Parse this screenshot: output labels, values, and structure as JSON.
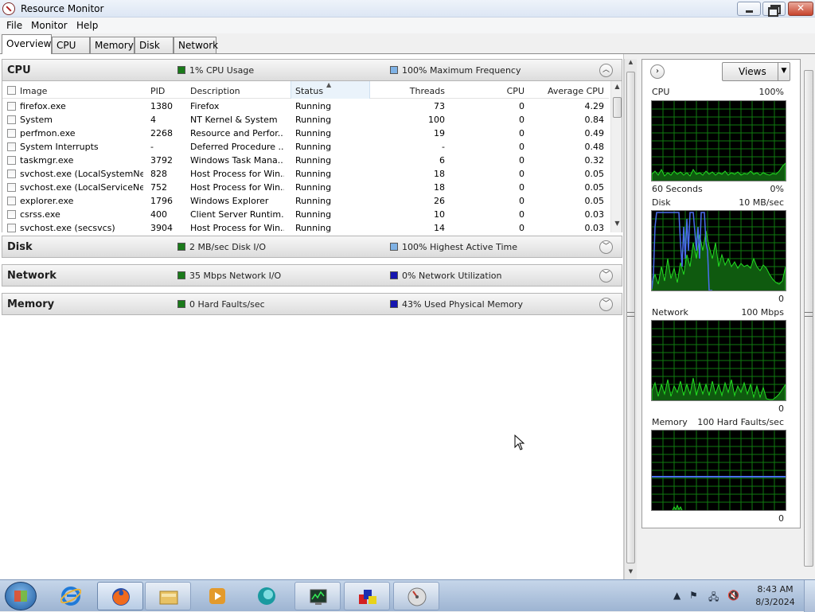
{
  "window": {
    "title": "Resource Monitor"
  },
  "menu": [
    "File",
    "Monitor",
    "Help"
  ],
  "tabs": [
    "Overview",
    "CPU",
    "Memory",
    "Disk",
    "Network"
  ],
  "cpu_section": {
    "title": "CPU",
    "usage": "1% CPU Usage",
    "frequency": "100% Maximum Frequency",
    "columns": [
      "Image",
      "PID",
      "Description",
      "Status",
      "Threads",
      "CPU",
      "Average CPU"
    ],
    "rows": [
      [
        "firefox.exe",
        "1380",
        "Firefox",
        "Running",
        "73",
        "0",
        "4.29"
      ],
      [
        "System",
        "4",
        "NT Kernel & System",
        "Running",
        "100",
        "0",
        "0.84"
      ],
      [
        "perfmon.exe",
        "2268",
        "Resource and Perfor...",
        "Running",
        "19",
        "0",
        "0.49"
      ],
      [
        "System Interrupts",
        "-",
        "Deferred Procedure ...",
        "Running",
        "-",
        "0",
        "0.48"
      ],
      [
        "taskmgr.exe",
        "3792",
        "Windows Task Mana...",
        "Running",
        "6",
        "0",
        "0.32"
      ],
      [
        "svchost.exe (LocalSystemNet...",
        "828",
        "Host Process for Win...",
        "Running",
        "18",
        "0",
        "0.05"
      ],
      [
        "svchost.exe (LocalServiceNet...",
        "752",
        "Host Process for Win...",
        "Running",
        "18",
        "0",
        "0.05"
      ],
      [
        "explorer.exe",
        "1796",
        "Windows Explorer",
        "Running",
        "26",
        "0",
        "0.05"
      ],
      [
        "csrss.exe",
        "400",
        "Client Server Runtim...",
        "Running",
        "10",
        "0",
        "0.03"
      ],
      [
        "svchost.exe (secsvcs)",
        "3904",
        "Host Process for Win...",
        "Running",
        "14",
        "0",
        "0.03"
      ]
    ]
  },
  "disk_section": {
    "title": "Disk",
    "io": "2 MB/sec Disk I/O",
    "active": "100% Highest Active Time"
  },
  "network_section": {
    "title": "Network",
    "io": "35 Mbps Network I/O",
    "util": "0% Network Utilization"
  },
  "memory_section": {
    "title": "Memory",
    "faults": "0 Hard Faults/sec",
    "used": "43% Used Physical Memory"
  },
  "right_panel": {
    "views_label": "Views",
    "graphs": [
      {
        "name": "CPU",
        "scale": "100%",
        "bottom_left": "60 Seconds",
        "bottom_right": "0%"
      },
      {
        "name": "Disk",
        "scale": "10 MB/sec",
        "bottom_left": "",
        "bottom_right": "0"
      },
      {
        "name": "Network",
        "scale": "100 Mbps",
        "bottom_left": "",
        "bottom_right": "0"
      },
      {
        "name": "Memory",
        "scale": "100 Hard Faults/sec",
        "bottom_left": "",
        "bottom_right": "0"
      }
    ]
  },
  "colors": {
    "green_legend": "#1a7a1a",
    "blue_light_legend": "#7fb2e5",
    "blue_dark_legend": "#1515b0",
    "graph_bg": "#000000",
    "graph_grid": "#0f7a0f",
    "graph_line_green": "#22dd22",
    "graph_line_blue": "#4a6ef0"
  },
  "taskbar": {
    "items": [
      "internet-explorer-icon",
      "firefox-icon",
      "file-explorer-icon",
      "media-player-icon",
      "app-globe-icon",
      "resource-monitor-icon",
      "paint-icon",
      "performance-icon"
    ],
    "clock_time": "8:43 AM",
    "clock_date": "8/3/2024"
  }
}
